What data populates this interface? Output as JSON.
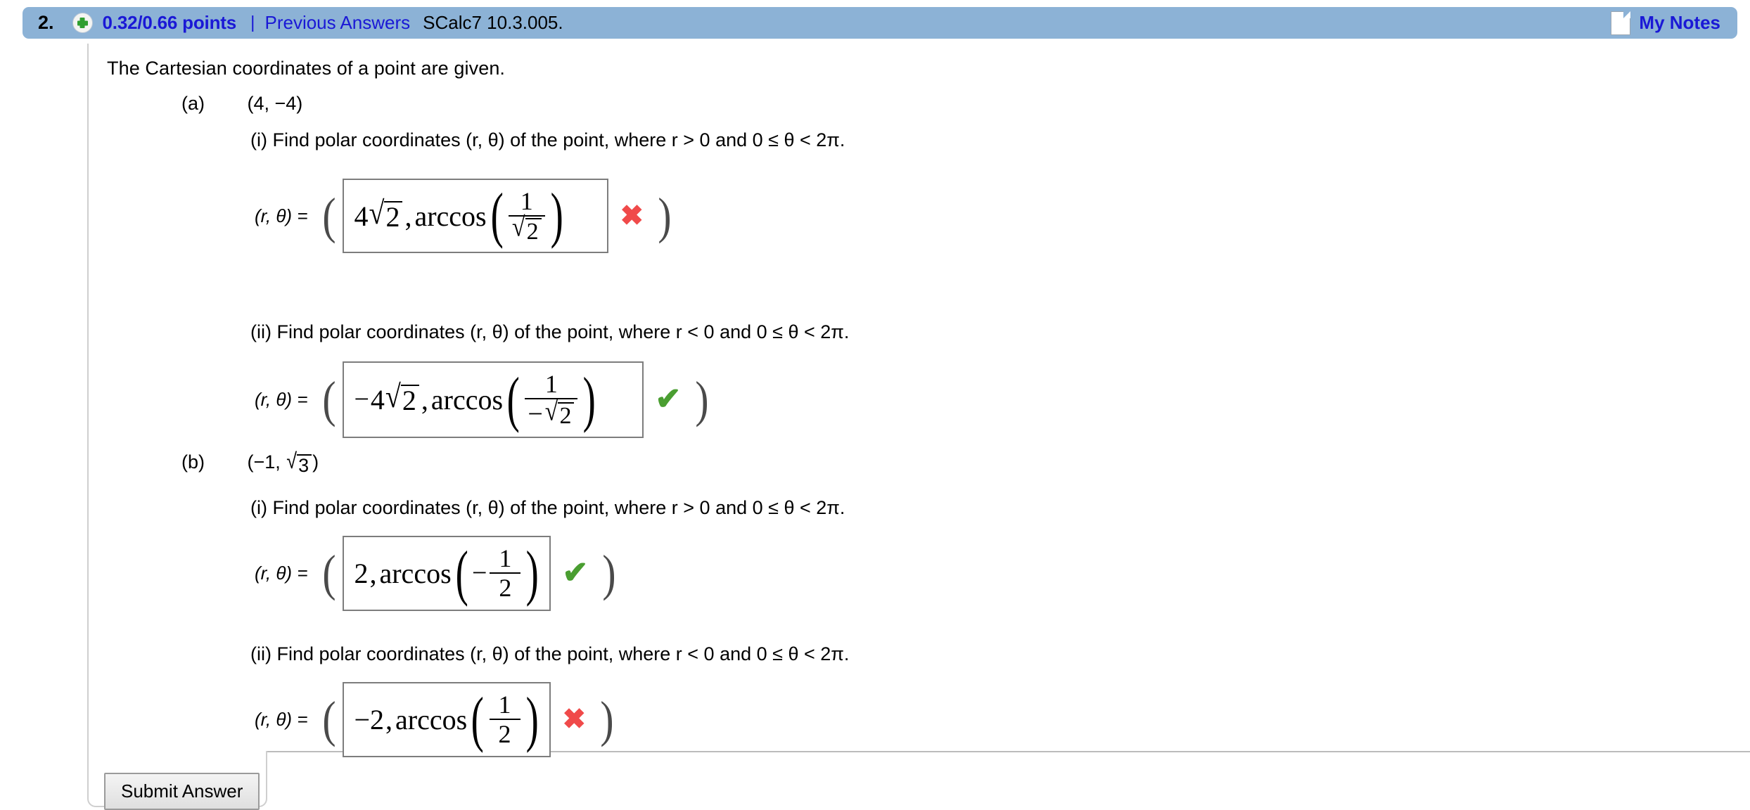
{
  "header": {
    "question_number": "2.",
    "plus_icon": "plus-circle-icon",
    "points": "0.32/0.66 points",
    "separator": "|",
    "previous_answers_label": "Previous Answers",
    "textbook_ref": "SCalc7 10.3.005.",
    "notes_icon": "note-page-icon",
    "my_notes_label": "My Notes",
    "bar_color": "#8cb2d6",
    "link_color": "#1a18d6"
  },
  "question": {
    "intro": "The Cartesian coordinates of a point are given."
  },
  "parts": [
    {
      "label": "(a)",
      "point": "(4, −4)",
      "subquestions": [
        {
          "roman": "(i)",
          "prompt_pre": "Find polar coordinates (",
          "prompt_text": "(i) Find polar coordinates (r, θ) of the point, where  r > 0 and 0 ≤ θ < 2π.",
          "r_condition": "r > 0",
          "theta_condition": "0 ≤ θ < 2π",
          "answer_prefix": "(r, θ)  =",
          "answer": {
            "r": "4√2",
            "r_coefficient": "4",
            "r_radicand": "2",
            "theta_function": "arccos",
            "theta_numerator": "1",
            "theta_denominator": "√2",
            "theta_denominator_radicand": "2",
            "denominator_negative": false,
            "r_negative": false
          },
          "status": "incorrect",
          "status_mark": "✖"
        },
        {
          "roman": "(ii)",
          "prompt_text": "(ii) Find polar coordinates (r, θ) of the point, where  r < 0 and 0 ≤ θ < 2π.",
          "r_condition": "r < 0",
          "theta_condition": "0 ≤ θ < 2π",
          "answer_prefix": "(r, θ)  =",
          "answer": {
            "r": "−4√2",
            "r_coefficient": "4",
            "r_radicand": "2",
            "theta_function": "arccos",
            "theta_numerator": "1",
            "theta_denominator": "−√2",
            "theta_denominator_radicand": "2",
            "denominator_negative": true,
            "r_negative": true
          },
          "status": "correct",
          "status_mark": "✔"
        }
      ]
    },
    {
      "label": "(b)",
      "point": "(−1, √3)",
      "point_radicand": "3",
      "subquestions": [
        {
          "roman": "(i)",
          "prompt_text": "(i) Find polar coordinates (r, θ) of the point, where  r > 0 and 0 ≤ θ < 2π.",
          "r_condition": "r > 0",
          "theta_condition": "0 ≤ θ < 2π",
          "answer_prefix": "(r, θ)  =",
          "answer": {
            "r": "2",
            "theta_function": "arccos",
            "theta_numerator": "1",
            "theta_denominator": "2",
            "theta_negative": true
          },
          "status": "correct",
          "status_mark": "✔"
        },
        {
          "roman": "(ii)",
          "prompt_text": "(ii) Find polar coordinates (r, θ) of the point, where  r < 0 and 0 ≤ θ < 2π.",
          "r_condition": "r < 0",
          "theta_condition": "0 ≤ θ < 2π",
          "answer_prefix": "(r, θ)  =",
          "answer": {
            "r": "−2",
            "theta_function": "arccos",
            "theta_numerator": "1",
            "theta_denominator": "2",
            "theta_negative": false
          },
          "status": "incorrect",
          "status_mark": "✖"
        }
      ]
    }
  ],
  "footer": {
    "submit_label": "Submit Answer"
  },
  "symbols": {
    "radical": "√",
    "paren_open": "(",
    "paren_close": ")",
    "minus": "−",
    "check": "✔",
    "cross": "✖"
  }
}
